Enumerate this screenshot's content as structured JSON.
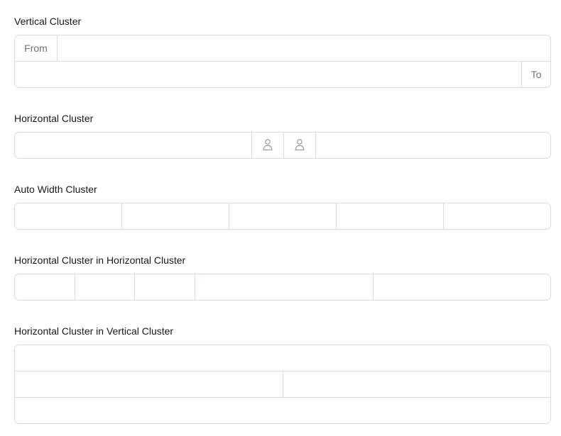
{
  "sections": {
    "vertical": {
      "label": "Vertical Cluster",
      "from_label": "From",
      "to_label": "To",
      "from_value": "",
      "to_value": ""
    },
    "horizontal": {
      "label": "Horizontal Cluster",
      "icons": [
        "user-icon",
        "user-icon"
      ]
    },
    "auto_width": {
      "label": "Auto Width Cluster",
      "field_count": 5
    },
    "h_in_h": {
      "label": "Horizontal Cluster in Horizontal Cluster"
    },
    "h_in_v": {
      "label": "Horizontal Cluster in Vertical Cluster"
    }
  },
  "colors": {
    "border": "#d9dde3",
    "label_text": "#18181b",
    "addon_text": "#71717a",
    "icon": "#8a8f98"
  }
}
